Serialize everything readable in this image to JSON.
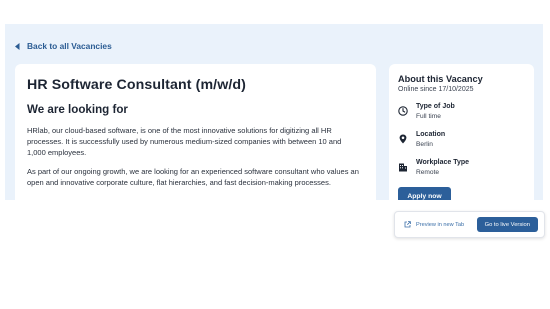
{
  "back_link": {
    "label": "Back to all Vacancies"
  },
  "job": {
    "title": "HR Software Consultant (m/w/d)",
    "section_heading": "We are looking for",
    "paragraphs": [
      "HRlab, our cloud-based software, is one of the most innovative solutions for digitizing all HR processes. It is successfully used by numerous medium-sized companies with between 10 and 1,000 employees.",
      "As part of our ongoing growth, we are looking for an experienced software consultant who values an open and innovative corporate culture, flat hierarchies, and fast decision-making processes."
    ]
  },
  "vacancy": {
    "title": "About this Vacancy",
    "online_since": "Online since 17/10/2025",
    "rows": [
      {
        "icon": "clock-icon",
        "label": "Type of Job",
        "value": "Full time"
      },
      {
        "icon": "location-pin-icon",
        "label": "Location",
        "value": "Berlin"
      },
      {
        "icon": "building-icon",
        "label": "Workplace Type",
        "value": "Remote"
      }
    ],
    "apply_label": "Apply now"
  },
  "preview_bar": {
    "new_tab_label": "Preview in new Tab",
    "live_label": "Go to live Version"
  },
  "colors": {
    "accent": "#2c5f9a",
    "page_background": "#eaf2fb",
    "link": "#2b5c93"
  }
}
